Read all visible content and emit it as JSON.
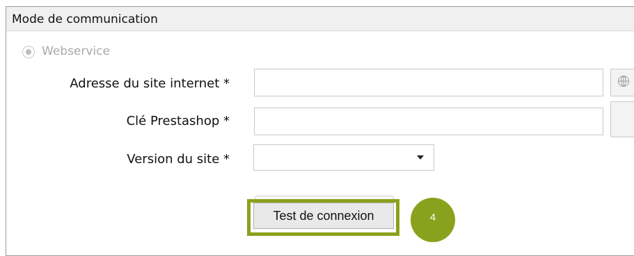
{
  "section": {
    "title": "Mode de communication"
  },
  "mode": {
    "radio_label": "Webservice"
  },
  "form": {
    "site_address_label": "Adresse du site internet *",
    "site_address_value": "",
    "prestashop_key_label": "Clé Prestashop *",
    "prestashop_key_value": "",
    "site_version_label": "Version du site *",
    "site_version_value": ""
  },
  "actions": {
    "test_connection_label": "Test de connexion"
  },
  "annotation": {
    "step_number": "4",
    "color": "#8aa11d"
  },
  "icons": {
    "site_button": "globe-icon"
  }
}
